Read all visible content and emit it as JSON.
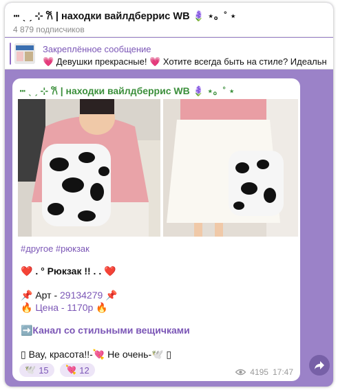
{
  "header": {
    "title": "ⵈ ˎ ˏ ⊹ 𐙚 | находки вайлдберрис WB 🪻 ⋆。˚ ⋆",
    "subscribers": "4 879 подписчиков"
  },
  "pinned": {
    "label": "Закреплённое сообщение",
    "text": "💗 Девушки прекрасные! 💗 Хотите всегда быть на стиле? Идеальн"
  },
  "message": {
    "author": "ⵈ ˎ ˏ ⊹ 𐙚 | находки вайлдберрис WB 🪻 ⋆。˚ ⋆",
    "tags": "#другое #рюкзак",
    "title": "❤️ . ° Рюкзак !! . . ❤️",
    "art_prefix": "📌 Арт - ",
    "art_number": "29134279",
    "art_suffix": " 📌",
    "price": "🔥 Цена - 1170р 🔥",
    "channel_link": "➡️Канал со стильными вещичками",
    "reaction_line": "▯ Вау, красота!!-💘 Не очень-🕊️ ▯",
    "reactions": [
      {
        "emoji": "🕊️",
        "count": "15"
      },
      {
        "emoji": "💘",
        "count": "12"
      }
    ],
    "views": "4195",
    "time": "17:47"
  },
  "colors": {
    "chat_background": "#9b82c8",
    "accent": "#7b56b6",
    "author": "#3b8f3b"
  },
  "icons": {
    "views": "eye-icon",
    "share": "share-arrow-icon"
  }
}
